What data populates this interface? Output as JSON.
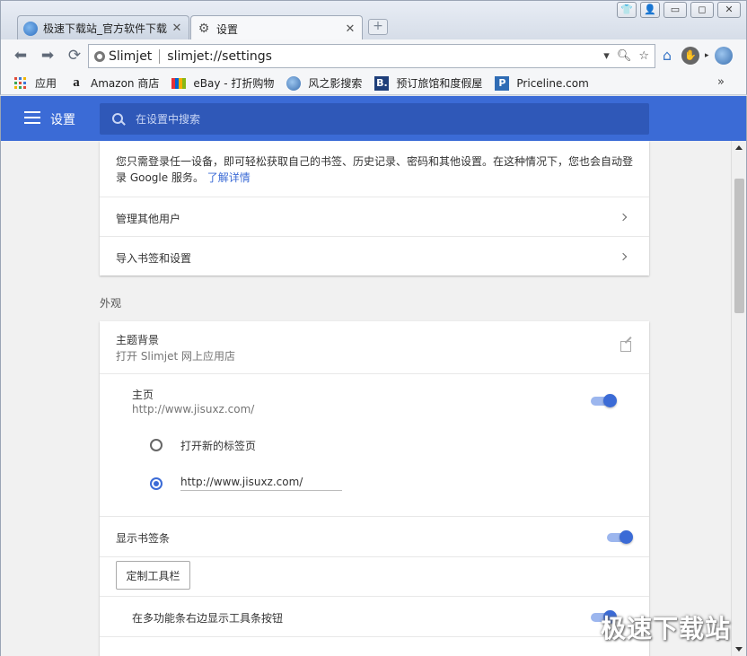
{
  "tabs": [
    {
      "title": "极速下载站_官方软件下载",
      "active": false
    },
    {
      "title": "设置",
      "active": true
    }
  ],
  "window_controls": {
    "shirt": "👕",
    "user": "👤",
    "minimize": "▭",
    "restore": "◻",
    "close": "✕"
  },
  "address_bar": {
    "site_name": "Slimjet",
    "url": "slimjet://settings"
  },
  "bookmarks": [
    {
      "label": "应用",
      "icon": "apps-grid-icon"
    },
    {
      "label": "Amazon 商店",
      "icon": "amazon-icon"
    },
    {
      "label": "eBay - 打折购物",
      "icon": "ebay-icon"
    },
    {
      "label": "风之影搜索",
      "icon": "globe-icon"
    },
    {
      "label": "预订旅馆和度假屋",
      "icon": "booking-icon"
    },
    {
      "label": "Priceline.com",
      "icon": "priceline-icon"
    }
  ],
  "header": {
    "title": "设置",
    "search_placeholder": "在设置中搜索"
  },
  "people": {
    "sync_text": "您只需登录任一设备，即可轻松获取自己的书签、历史记录、密码和其他设置。在这种情况下，您也会自动登录 Google 服务。",
    "learn_more": "了解详情",
    "manage_users": "管理其他用户",
    "import": "导入书签和设置"
  },
  "appearance": {
    "section_title": "外观",
    "theme_title": "主题背景",
    "theme_sub": "打开 Slimjet 网上应用店",
    "home_title": "主页",
    "home_url": "http://www.jisuxz.com/",
    "home_enabled": true,
    "radio_newtab": "打开新的标签页",
    "radio_custom_value": "http://www.jisuxz.com/",
    "show_bookmarks": "显示书签条",
    "show_bookmarks_enabled": true,
    "customize_toolbar": "定制工具栏",
    "show_toolbar_buttons": "在多功能条右边显示工具条按钮",
    "show_toolbar_buttons_enabled": true
  },
  "watermark": "极速下载站",
  "colors": {
    "accent": "#3b6bd6",
    "header": "#3b6bd6"
  }
}
